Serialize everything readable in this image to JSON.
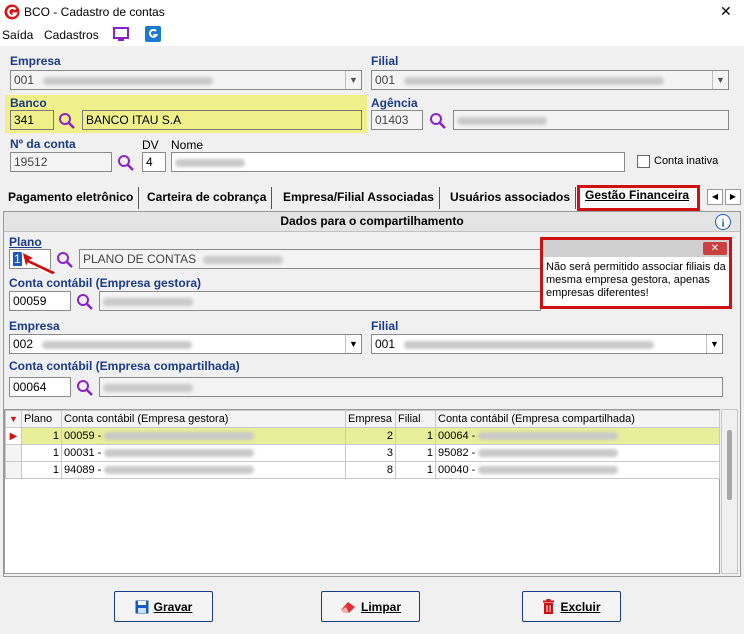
{
  "window": {
    "title": "BCO - Cadastro de contas",
    "close": "✕"
  },
  "menu": {
    "items": [
      "Saída",
      "Cadastros"
    ]
  },
  "empresa": {
    "label": "Empresa",
    "code": "001"
  },
  "filial": {
    "label": "Filial",
    "code": "001"
  },
  "banco": {
    "label": "Banco",
    "code": "341",
    "name": "BANCO ITAU S.A"
  },
  "agencia": {
    "label": "Agência",
    "code": "01403"
  },
  "conta": {
    "label": "Nº da conta",
    "number": "19512",
    "dv_label": "DV",
    "dv": "4",
    "nome_label": "Nome",
    "inativa_label": "Conta inativa"
  },
  "tabs": [
    "Pagamento eletrônico",
    "Carteira de cobrança",
    "Empresa/Filial Associadas",
    "Usuários associados",
    "Gestão Financeira"
  ],
  "panel": {
    "header": "Dados para o compartilhamento",
    "plano_label": "Plano",
    "plano_value": "1",
    "plano_name": "PLANO DE CONTAS",
    "gestora_label": "Conta contábil (Empresa gestora)",
    "gestora_value": "00059",
    "empresa_label": "Empresa",
    "empresa_value": "002",
    "filial_label": "Filial",
    "filial_value": "001",
    "compartilhada_label": "Conta contábil (Empresa compartilhada)",
    "compartilhada_value": "00064"
  },
  "tooltip": {
    "close": "✕",
    "text": "Não será permitido associar filiais da mesma empresa gestora, apenas empresas diferentes!"
  },
  "grid": {
    "columns": [
      "Plano",
      "Conta contábil (Empresa gestora)",
      "Empresa",
      "Filial",
      "Conta contábil (Empresa compartilhada)"
    ],
    "rows": [
      {
        "plano": "1",
        "gestora": "00059 -",
        "empresa": "2",
        "filial": "1",
        "compartilhada": "00064 -"
      },
      {
        "plano": "1",
        "gestora": "00031 -",
        "empresa": "3",
        "filial": "1",
        "compartilhada": "95082 -"
      },
      {
        "plano": "1",
        "gestora": "94089 -",
        "empresa": "8",
        "filial": "1",
        "compartilhada": "00040 -"
      }
    ]
  },
  "buttons": {
    "gravar": "Gravar",
    "limpar": "Limpar",
    "excluir": "Excluir"
  },
  "colors": {
    "highlight": "#f0f08a",
    "accent_red": "#d01010",
    "label_blue": "#1a3a8c"
  }
}
